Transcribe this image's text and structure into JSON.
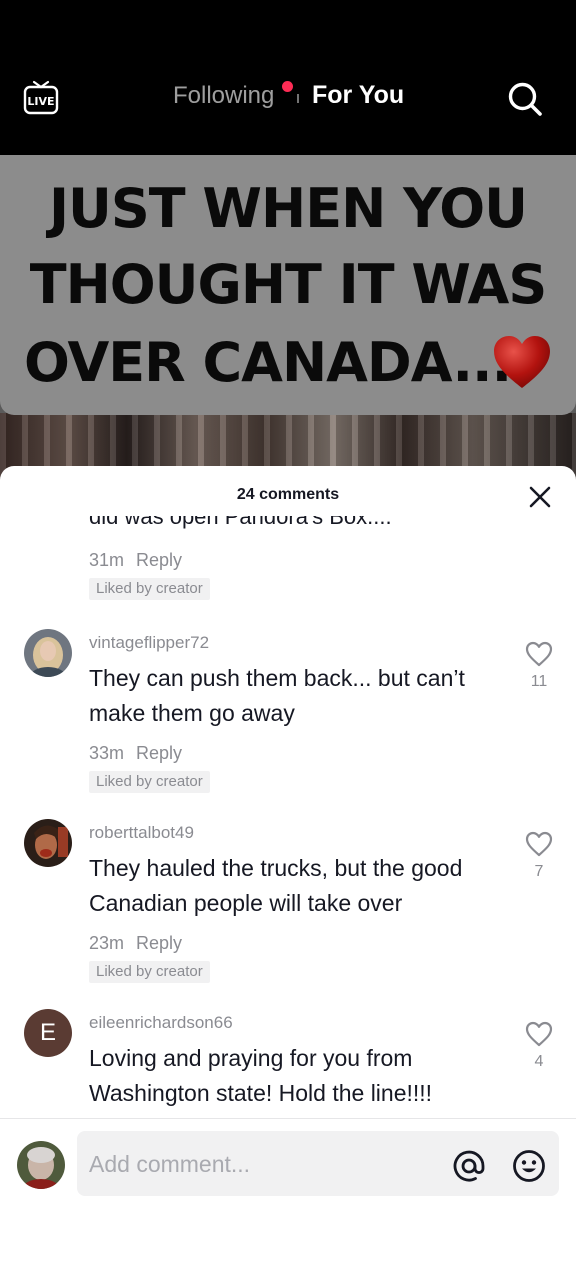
{
  "header": {
    "live_label": "LIVE",
    "tab_following": "Following",
    "tab_for_you": "For You",
    "live_dot_color": "#fe2c55",
    "search_icon": "search-icon"
  },
  "video": {
    "caption_line1": "JUST WHEN YOU",
    "caption_line2": "THOUGHT IT WAS",
    "caption_line3": "OVER CANADA...",
    "caption_emoji": "red-heart"
  },
  "comments_sheet": {
    "title": "24 comments",
    "close_icon": "close-icon",
    "partial_comment": {
      "text": "did was open Pandora's Box....",
      "time": "31m",
      "reply_label": "Reply",
      "badge": "Liked by creator"
    },
    "comments": [
      {
        "username": "vintageflipper72",
        "text": "They can push them back... but can’t make them go away",
        "time": "33m",
        "reply_label": "Reply",
        "badge": "Liked by creator",
        "likes": "11"
      },
      {
        "username": "roberttalbot49",
        "text": "They hauled the trucks, but the good Canadian people will take over",
        "time": "23m",
        "reply_label": "Reply",
        "badge": "Liked by creator",
        "likes": "7"
      },
      {
        "username": "eileenrichardson66",
        "avatar_letter": "E",
        "text": "Loving and praying for you from Washington state! Hold the line!!!!",
        "likes": "4"
      }
    ]
  },
  "comment_input": {
    "placeholder": "Add comment...",
    "mention_icon": "at-icon",
    "emoji_icon": "emoji-icon"
  }
}
